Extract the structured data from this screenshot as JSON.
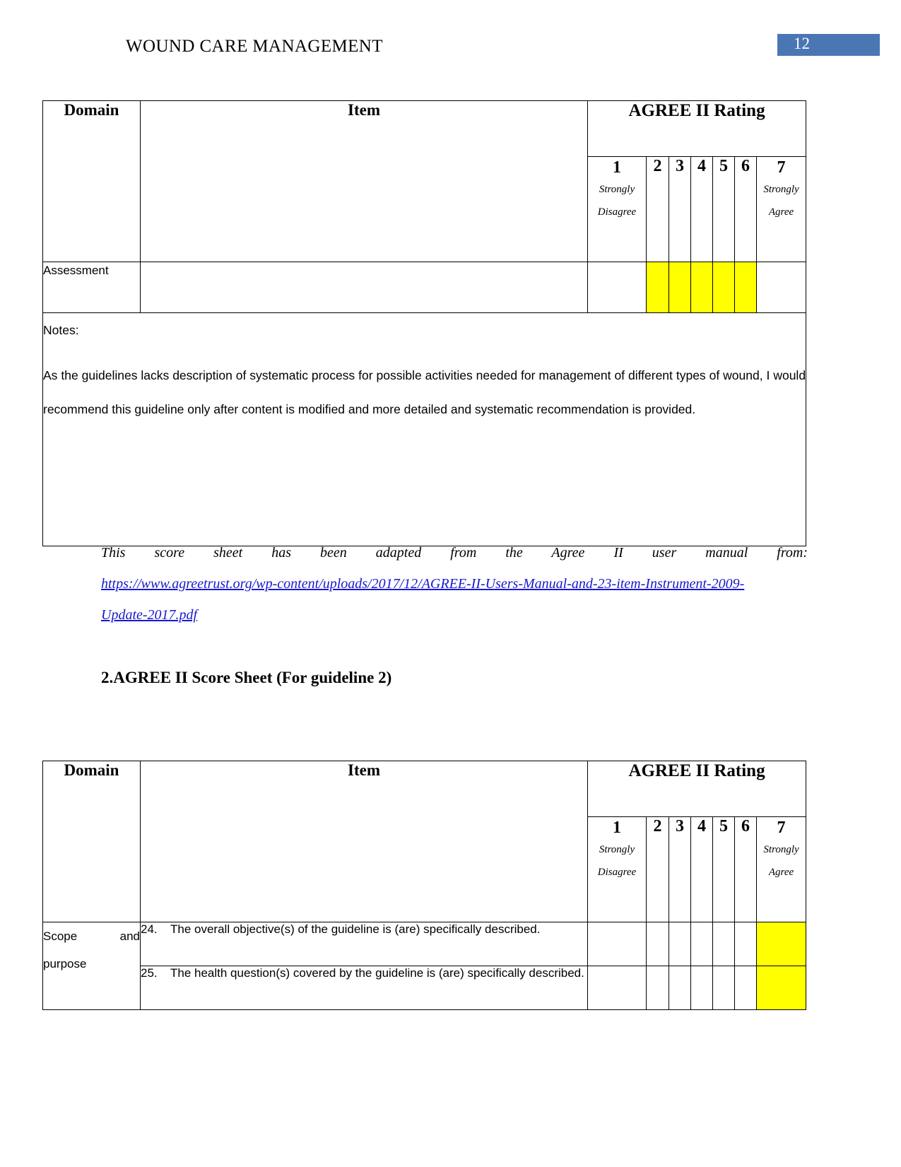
{
  "header": {
    "title": "WOUND CARE MANAGEMENT",
    "page_number": "12",
    "page_number_bg": "#4a77b4"
  },
  "rating_scale": {
    "group_label": "AGREE II Rating",
    "domain_label": "Domain",
    "item_label": "Item",
    "low_num": "1",
    "low_sub_line1": "Strongly",
    "low_sub_line2": "Disagree",
    "mid_nums": [
      "2",
      "3",
      "4",
      "5",
      "6"
    ],
    "high_num": "7",
    "high_sub_line1": "Strongly",
    "high_sub_line2": "Agree",
    "highlight_color": "#ffff00"
  },
  "table1": {
    "rows": [
      {
        "domain": "Assessment",
        "item": "",
        "highlighted_ratings": [
          "2",
          "3",
          "4",
          "5",
          "6"
        ]
      }
    ],
    "notes": {
      "label": "Notes:",
      "text": "As the guidelines lacks description of systematic process for possible activities needed for management of different types of wound, I would recommend this guideline only after content is modified and more detailed and systematic recommendation is provided."
    }
  },
  "source": {
    "sentence": "This score sheet has been adapted from the Agree II user manual from:",
    "url_line1": "https://www.agreetrust.org/wp-content/uploads/2017/12/AGREE-II-Users-Manual-and-23-item-Instrument-2009-",
    "url_line2": "Update-2017.pdf"
  },
  "section2": {
    "heading": "2.AGREE II Score Sheet (For guideline 2)"
  },
  "table2": {
    "domain": "Scope and purpose",
    "domain_word1": "Scope",
    "domain_word2": "and",
    "domain_word3": "purpose",
    "rows": [
      {
        "number": "24.",
        "item": "The overall objective(s) of the guideline is (are) specifically described.",
        "highlighted_ratings": [
          "7"
        ]
      },
      {
        "number": "25.",
        "item": "The health question(s) covered by the guideline is (are) specifically described.",
        "highlighted_ratings": [
          "7"
        ]
      }
    ]
  }
}
